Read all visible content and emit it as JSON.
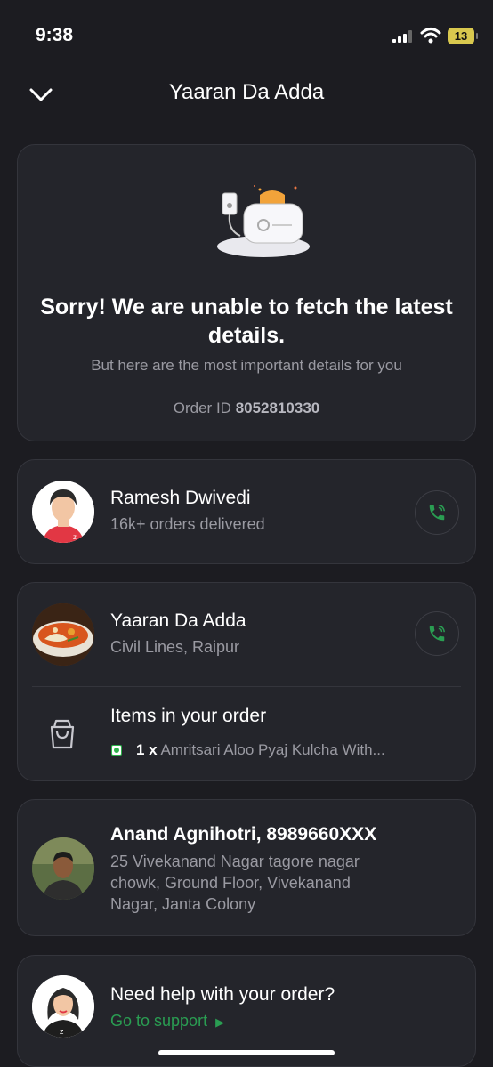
{
  "status_bar": {
    "time": "9:38",
    "battery": "13"
  },
  "header": {
    "title": "Yaaran Da Adda"
  },
  "notice": {
    "title": "Sorry! We are unable to fetch the latest details.",
    "subtitle": "But here are the most important details for you",
    "order_id_label": "Order ID",
    "order_id": "8052810330"
  },
  "rider": {
    "name": "Ramesh Dwivedi",
    "subtitle": "16k+ orders delivered"
  },
  "restaurant": {
    "name": "Yaaran Da Adda",
    "location": "Civil Lines, Raipur"
  },
  "order_items": {
    "heading": "Items in your order",
    "quantity": "1 x",
    "item": "Amritsari Aloo Pyaj Kulcha With..."
  },
  "delivery": {
    "name": "Anand Agnihotri, 8989660XXX",
    "address_line1": "25 Vivekanand Nagar tagore nagar",
    "address_line2": "chowk, Ground Floor, Vivekanand",
    "address_line3": "Nagar, Janta Colony"
  },
  "support": {
    "title": "Need help with your order?",
    "link": "Go to support"
  },
  "colors": {
    "background": "#1c1c21",
    "card": "#24252b",
    "accent_green": "#2a9d52"
  }
}
